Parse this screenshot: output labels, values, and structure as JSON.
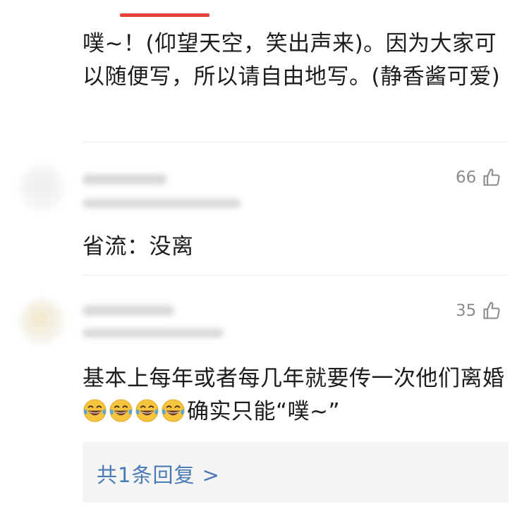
{
  "comment_1": {
    "text": "噗~！(仰望天空，笑出声来)。因为大家可以随便写，所以请自由地写。(静香酱可爱)"
  },
  "comment_2": {
    "likes": "66",
    "text": "省流：没离"
  },
  "comment_3": {
    "likes": "35",
    "text_before": "基本上每年或者每几年就要传一次他们离婚",
    "emoji": "laughing-tears-emoji",
    "emoji_count": 4,
    "text_after": "确实只能“噗~”"
  },
  "replies": {
    "label": "共1条回复 >"
  },
  "colors": {
    "accent": "#e8413a",
    "link": "#4a79b6",
    "like_gray": "#8c8c8c"
  },
  "icons": [
    "thumbs-up-icon",
    "laughing-tears-emoji"
  ]
}
